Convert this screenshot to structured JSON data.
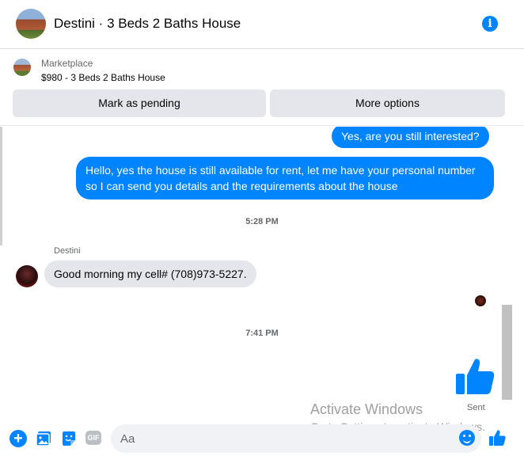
{
  "header": {
    "title": "Destini · 3 Beds 2 Baths House",
    "info_glyph": "i",
    "info_icon": "info-icon"
  },
  "marketplace": {
    "label": "Marketplace",
    "listing": "$980 - 3 Beds 2 Baths House",
    "mark_pending_label": "Mark as pending",
    "more_options_label": "More options"
  },
  "messages": {
    "out_1": "Yes, are you still interested?",
    "out_2": "Hello, yes the house is still available for rent, let me have your personal number so I can send you details and the requirements about the house",
    "time_1": "5:28 PM",
    "sender": "Destini",
    "in_1": "Good morning my cell# (708)973-5227.",
    "time_2": "7:41 PM",
    "status": "Sent"
  },
  "composer": {
    "placeholder": "Aa",
    "plus_glyph": "+",
    "gif_label": "GIF"
  },
  "watermark": {
    "line1": "Activate Windows",
    "line2": "Go to Settings to activate Windows."
  },
  "colors": {
    "accent": "#0084ff",
    "bubble_in": "#e4e6eb",
    "button_bg": "#e4e6eb",
    "muted_text": "#65676b"
  }
}
